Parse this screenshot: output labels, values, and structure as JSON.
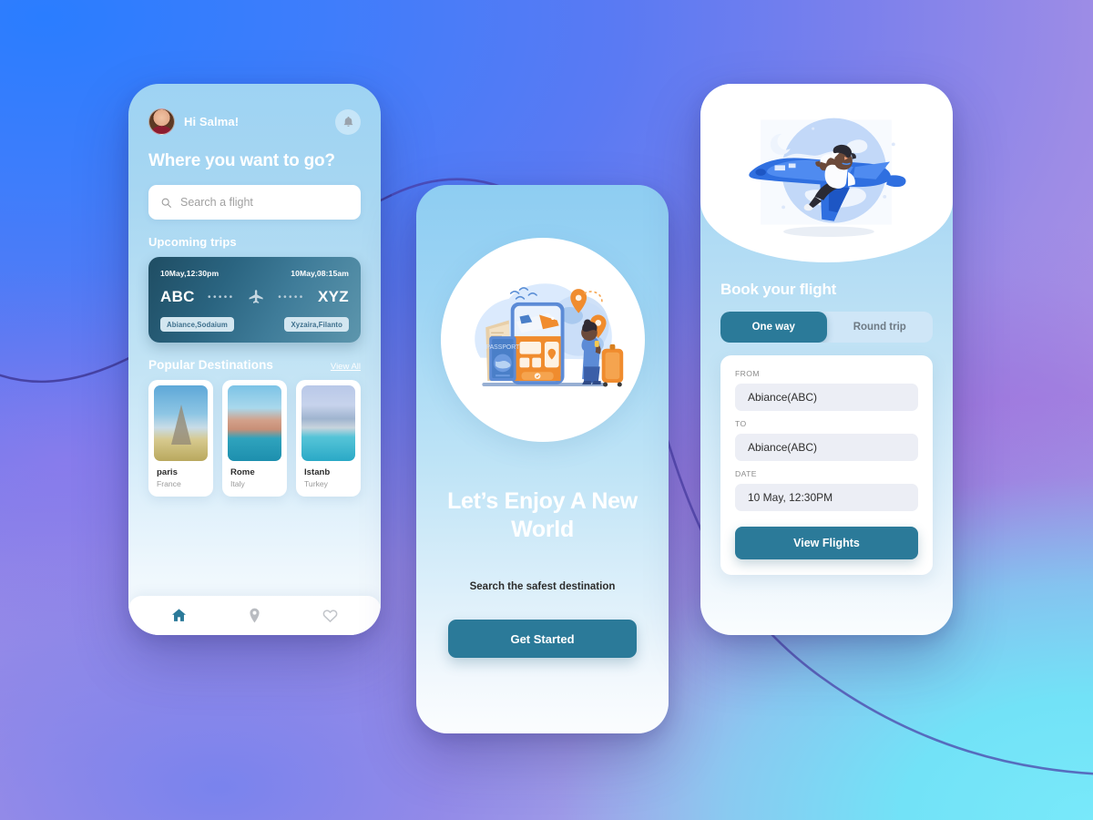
{
  "theme": {
    "accent_teal": "#2b7a99",
    "bg_blue": "#2a7dff",
    "bg_violet": "#7b80ec",
    "bg_cyan": "#78e9fa",
    "card_white": "#ffffff"
  },
  "home": {
    "greeting": "Hi Salma!",
    "avatar_alt": "user-avatar",
    "bell_icon": "bell-icon",
    "title": "Where you want to go?",
    "search": {
      "icon": "search-icon",
      "placeholder": "Search  a flight",
      "value": ""
    },
    "upcoming": {
      "heading": "Upcoming trips",
      "depart_time": "10May,12:30pm",
      "arrive_time": "10May,08:15am",
      "from_code": "ABC",
      "to_code": "XYZ",
      "dots": "•••••",
      "plane_icon": "airplane-icon",
      "from_tag": "Abiance,Sodaium",
      "to_tag": "Xyzaira,Filanto"
    },
    "popular": {
      "heading": "Popular Destinations",
      "view_all": "View All",
      "items": [
        {
          "name": "paris",
          "country": "France",
          "image": "eiffel-tower-photo"
        },
        {
          "name": "Rome",
          "country": "Italy",
          "image": "rialto-bridge-photo"
        },
        {
          "name": "Istanb",
          "country": "Turkey",
          "image": "istanbul-mosque-photo"
        }
      ]
    },
    "nav": [
      {
        "icon": "home-icon",
        "active": true
      },
      {
        "icon": "location-pin-icon",
        "active": false
      },
      {
        "icon": "heart-icon",
        "active": false
      }
    ]
  },
  "onboarding": {
    "illustration": "travel-booking-illustration",
    "title": "Let’s Enjoy A New World",
    "subtitle": "Search the safest destination",
    "cta": "Get Started"
  },
  "booking": {
    "illustration": "man-riding-airplane-illustration",
    "title": "Book your flight",
    "trip_types": [
      {
        "label": "One way",
        "active": true
      },
      {
        "label": "Round trip",
        "active": false
      }
    ],
    "fields": [
      {
        "label": "FROM",
        "value": "Abiance(ABC)"
      },
      {
        "label": "TO",
        "value": "Abiance(ABC)"
      },
      {
        "label": "DATE",
        "value": "10 May, 12:30PM"
      }
    ],
    "cta": "View Flights"
  }
}
